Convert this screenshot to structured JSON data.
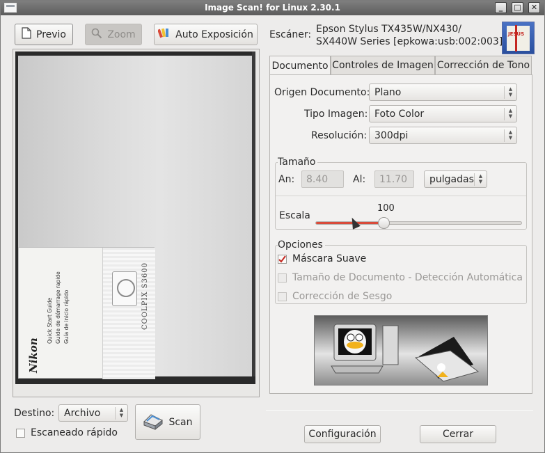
{
  "window": {
    "title": "Image Scan! for Linux 2.30.1",
    "controls": [
      "_",
      "□",
      "✕"
    ]
  },
  "toolbar": {
    "preview_label": "Previo",
    "zoom_label": "Zoom",
    "auto_exposure_label": "Auto Exposición"
  },
  "scanner": {
    "label": "Escáner:",
    "device_line1": "Epson Stylus TX435W/NX430/",
    "device_line2": "SX440W Series [epkowa:usb:002:003]"
  },
  "tabs": [
    {
      "label": "Documento",
      "active": true
    },
    {
      "label": "Controles de Imagen",
      "active": false
    },
    {
      "label": "Corrección de Tono",
      "active": false
    }
  ],
  "document": {
    "source_label": "Origen Documento:",
    "source_value": "Plano",
    "image_type_label": "Tipo Imagen:",
    "image_type_value": "Foto Color",
    "resolution_label": "Resolución:",
    "resolution_value": "300dpi"
  },
  "size": {
    "title": "Tamaño",
    "width_label": "An:",
    "width_value": "8.40",
    "height_label": "Al:",
    "height_value": "11.70",
    "unit_value": "pulgadas",
    "scale_label": "Escala",
    "scale_value": "100",
    "scale_fraction": 0.33
  },
  "options": {
    "title": "Opciones",
    "unsharp_mask_label": "Máscara Suave",
    "unsharp_mask_checked": true,
    "auto_detect_label": "Tamaño de Documento - Detección Automática",
    "auto_detect_checked": false,
    "deskew_label": "Corrección de Sesgo",
    "deskew_checked": false
  },
  "preview_image": {
    "brand": "Nikon",
    "guide_lines": [
      "Quick Start Guide",
      "Guide de démarrage rapide",
      "Guía de inicio rápido"
    ],
    "model": "COOLPIX S3600"
  },
  "bottom": {
    "destination_label": "Destino:",
    "destination_value": "Archivo",
    "quick_scan_label": "Escaneado rápido",
    "scan_label": "Scan",
    "config_label": "Configuración",
    "close_label": "Cerrar"
  },
  "colors": {
    "accent_red": "#d94b3a",
    "check_red": "#c4261f"
  },
  "icons": {
    "preview": "document-icon",
    "zoom": "magnifier-icon",
    "auto_exposure": "color-palette-icon",
    "scan": "scanner-icon"
  }
}
